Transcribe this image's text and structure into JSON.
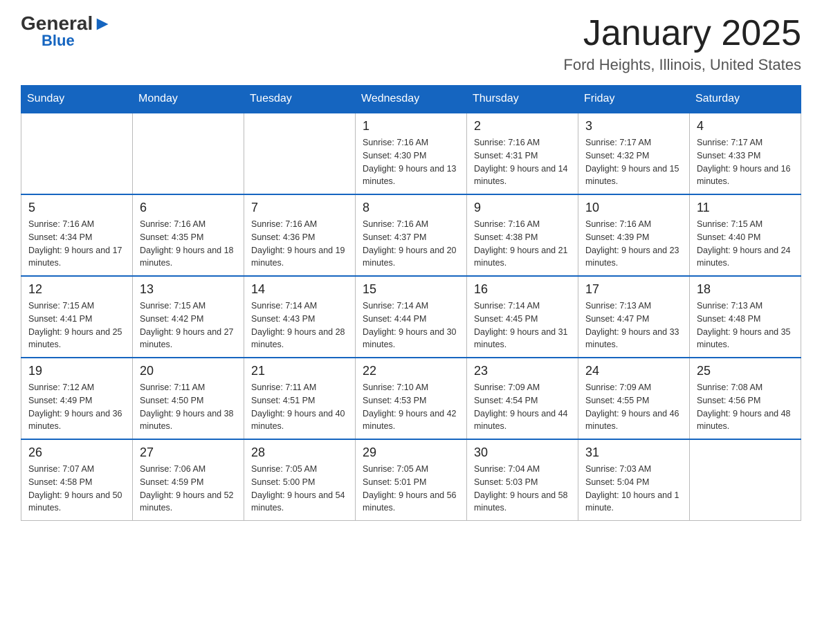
{
  "logo": {
    "general": "General",
    "blue": "Blue",
    "triangle": "▲"
  },
  "title": "January 2025",
  "subtitle": "Ford Heights, Illinois, United States",
  "days_of_week": [
    "Sunday",
    "Monday",
    "Tuesday",
    "Wednesday",
    "Thursday",
    "Friday",
    "Saturday"
  ],
  "weeks": [
    [
      {
        "day": "",
        "info": ""
      },
      {
        "day": "",
        "info": ""
      },
      {
        "day": "",
        "info": ""
      },
      {
        "day": "1",
        "info": "Sunrise: 7:16 AM\nSunset: 4:30 PM\nDaylight: 9 hours\nand 13 minutes."
      },
      {
        "day": "2",
        "info": "Sunrise: 7:16 AM\nSunset: 4:31 PM\nDaylight: 9 hours\nand 14 minutes."
      },
      {
        "day": "3",
        "info": "Sunrise: 7:17 AM\nSunset: 4:32 PM\nDaylight: 9 hours\nand 15 minutes."
      },
      {
        "day": "4",
        "info": "Sunrise: 7:17 AM\nSunset: 4:33 PM\nDaylight: 9 hours\nand 16 minutes."
      }
    ],
    [
      {
        "day": "5",
        "info": "Sunrise: 7:16 AM\nSunset: 4:34 PM\nDaylight: 9 hours\nand 17 minutes."
      },
      {
        "day": "6",
        "info": "Sunrise: 7:16 AM\nSunset: 4:35 PM\nDaylight: 9 hours\nand 18 minutes."
      },
      {
        "day": "7",
        "info": "Sunrise: 7:16 AM\nSunset: 4:36 PM\nDaylight: 9 hours\nand 19 minutes."
      },
      {
        "day": "8",
        "info": "Sunrise: 7:16 AM\nSunset: 4:37 PM\nDaylight: 9 hours\nand 20 minutes."
      },
      {
        "day": "9",
        "info": "Sunrise: 7:16 AM\nSunset: 4:38 PM\nDaylight: 9 hours\nand 21 minutes."
      },
      {
        "day": "10",
        "info": "Sunrise: 7:16 AM\nSunset: 4:39 PM\nDaylight: 9 hours\nand 23 minutes."
      },
      {
        "day": "11",
        "info": "Sunrise: 7:15 AM\nSunset: 4:40 PM\nDaylight: 9 hours\nand 24 minutes."
      }
    ],
    [
      {
        "day": "12",
        "info": "Sunrise: 7:15 AM\nSunset: 4:41 PM\nDaylight: 9 hours\nand 25 minutes."
      },
      {
        "day": "13",
        "info": "Sunrise: 7:15 AM\nSunset: 4:42 PM\nDaylight: 9 hours\nand 27 minutes."
      },
      {
        "day": "14",
        "info": "Sunrise: 7:14 AM\nSunset: 4:43 PM\nDaylight: 9 hours\nand 28 minutes."
      },
      {
        "day": "15",
        "info": "Sunrise: 7:14 AM\nSunset: 4:44 PM\nDaylight: 9 hours\nand 30 minutes."
      },
      {
        "day": "16",
        "info": "Sunrise: 7:14 AM\nSunset: 4:45 PM\nDaylight: 9 hours\nand 31 minutes."
      },
      {
        "day": "17",
        "info": "Sunrise: 7:13 AM\nSunset: 4:47 PM\nDaylight: 9 hours\nand 33 minutes."
      },
      {
        "day": "18",
        "info": "Sunrise: 7:13 AM\nSunset: 4:48 PM\nDaylight: 9 hours\nand 35 minutes."
      }
    ],
    [
      {
        "day": "19",
        "info": "Sunrise: 7:12 AM\nSunset: 4:49 PM\nDaylight: 9 hours\nand 36 minutes."
      },
      {
        "day": "20",
        "info": "Sunrise: 7:11 AM\nSunset: 4:50 PM\nDaylight: 9 hours\nand 38 minutes."
      },
      {
        "day": "21",
        "info": "Sunrise: 7:11 AM\nSunset: 4:51 PM\nDaylight: 9 hours\nand 40 minutes."
      },
      {
        "day": "22",
        "info": "Sunrise: 7:10 AM\nSunset: 4:53 PM\nDaylight: 9 hours\nand 42 minutes."
      },
      {
        "day": "23",
        "info": "Sunrise: 7:09 AM\nSunset: 4:54 PM\nDaylight: 9 hours\nand 44 minutes."
      },
      {
        "day": "24",
        "info": "Sunrise: 7:09 AM\nSunset: 4:55 PM\nDaylight: 9 hours\nand 46 minutes."
      },
      {
        "day": "25",
        "info": "Sunrise: 7:08 AM\nSunset: 4:56 PM\nDaylight: 9 hours\nand 48 minutes."
      }
    ],
    [
      {
        "day": "26",
        "info": "Sunrise: 7:07 AM\nSunset: 4:58 PM\nDaylight: 9 hours\nand 50 minutes."
      },
      {
        "day": "27",
        "info": "Sunrise: 7:06 AM\nSunset: 4:59 PM\nDaylight: 9 hours\nand 52 minutes."
      },
      {
        "day": "28",
        "info": "Sunrise: 7:05 AM\nSunset: 5:00 PM\nDaylight: 9 hours\nand 54 minutes."
      },
      {
        "day": "29",
        "info": "Sunrise: 7:05 AM\nSunset: 5:01 PM\nDaylight: 9 hours\nand 56 minutes."
      },
      {
        "day": "30",
        "info": "Sunrise: 7:04 AM\nSunset: 5:03 PM\nDaylight: 9 hours\nand 58 minutes."
      },
      {
        "day": "31",
        "info": "Sunrise: 7:03 AM\nSunset: 5:04 PM\nDaylight: 10 hours\nand 1 minute."
      },
      {
        "day": "",
        "info": ""
      }
    ]
  ]
}
